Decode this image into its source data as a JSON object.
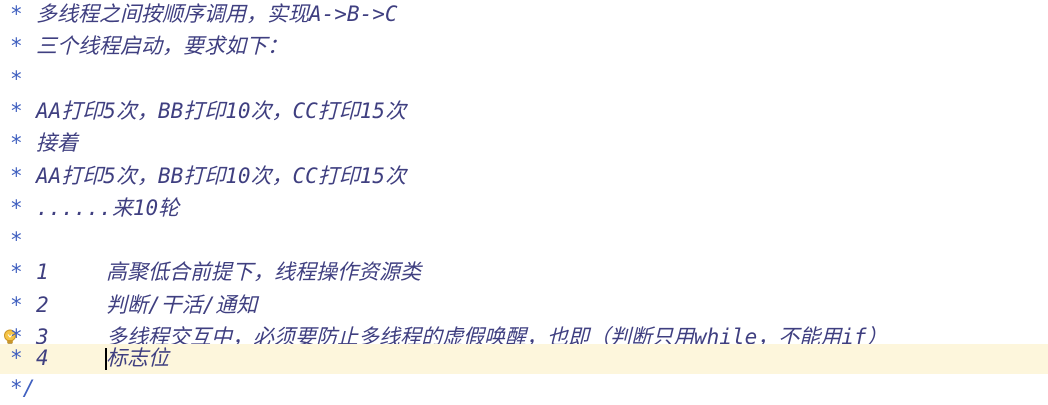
{
  "editor": {
    "comment_marker": "*",
    "closing": "*/",
    "lines": [
      "多线程之间按顺序调用，实现A->B->C",
      "三个线程启动，要求如下：",
      "",
      "AA打印5次，BB打印10次，CC打印15次",
      "接着",
      "AA打印5次，BB打印10次，CC打印15次",
      "......来10轮",
      ""
    ],
    "items": [
      {
        "num": "1",
        "text": "高聚低合前提下，线程操作资源类"
      },
      {
        "num": "2",
        "text": "判断/干活/通知"
      },
      {
        "num": "3",
        "text": "多线程交互中，必须要防止多线程的虚假唤醒，也即（判断只用while，不能用if）"
      },
      {
        "num": "4",
        "text": "标志位"
      }
    ],
    "current_line_highlight": "#fdf6dc",
    "comment_color": "#3f3f80",
    "icons": {
      "quick_fix": "lightbulb-icon"
    }
  }
}
